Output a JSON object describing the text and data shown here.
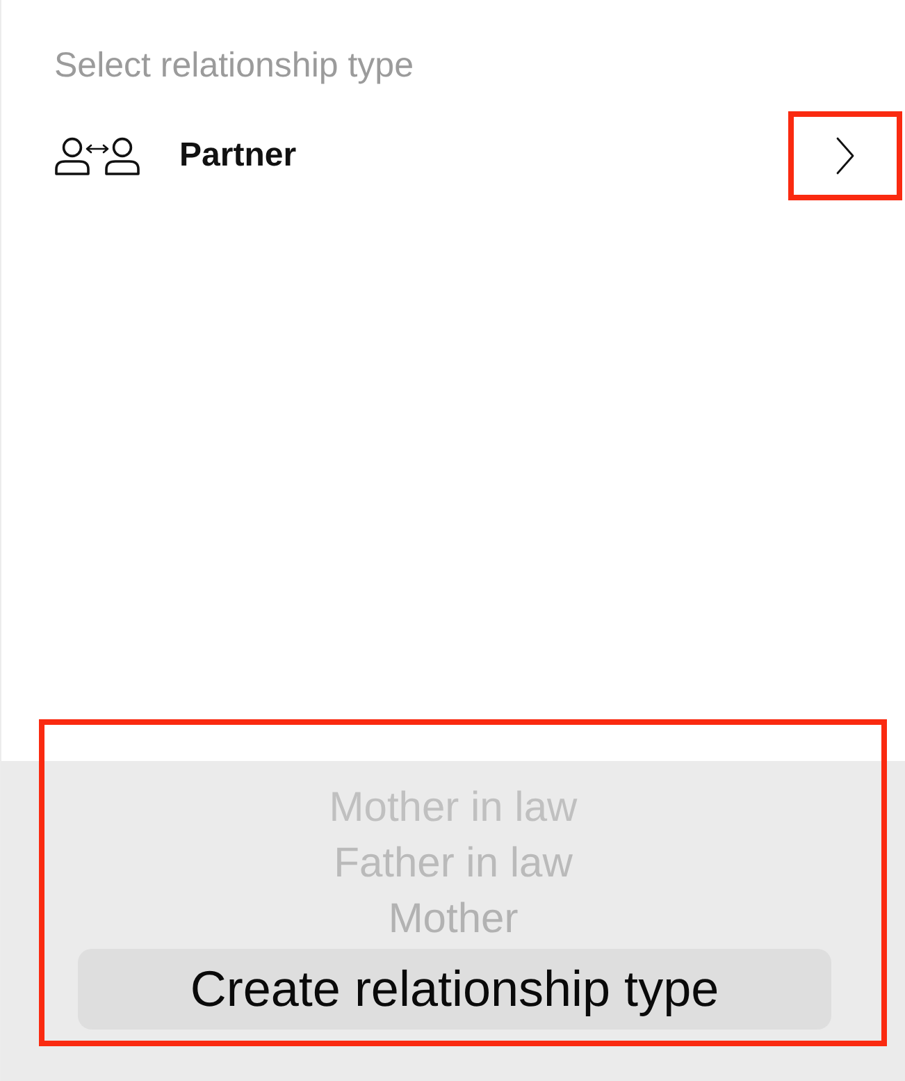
{
  "header": {
    "label": "Select relationship type"
  },
  "relationship": {
    "label": "Partner",
    "chevron_highlighted": true
  },
  "picker": {
    "options": [
      "Mother in law",
      "Father in law",
      "Mother"
    ],
    "highlighted": true
  },
  "create_button": {
    "label": "Create relationship type"
  }
}
